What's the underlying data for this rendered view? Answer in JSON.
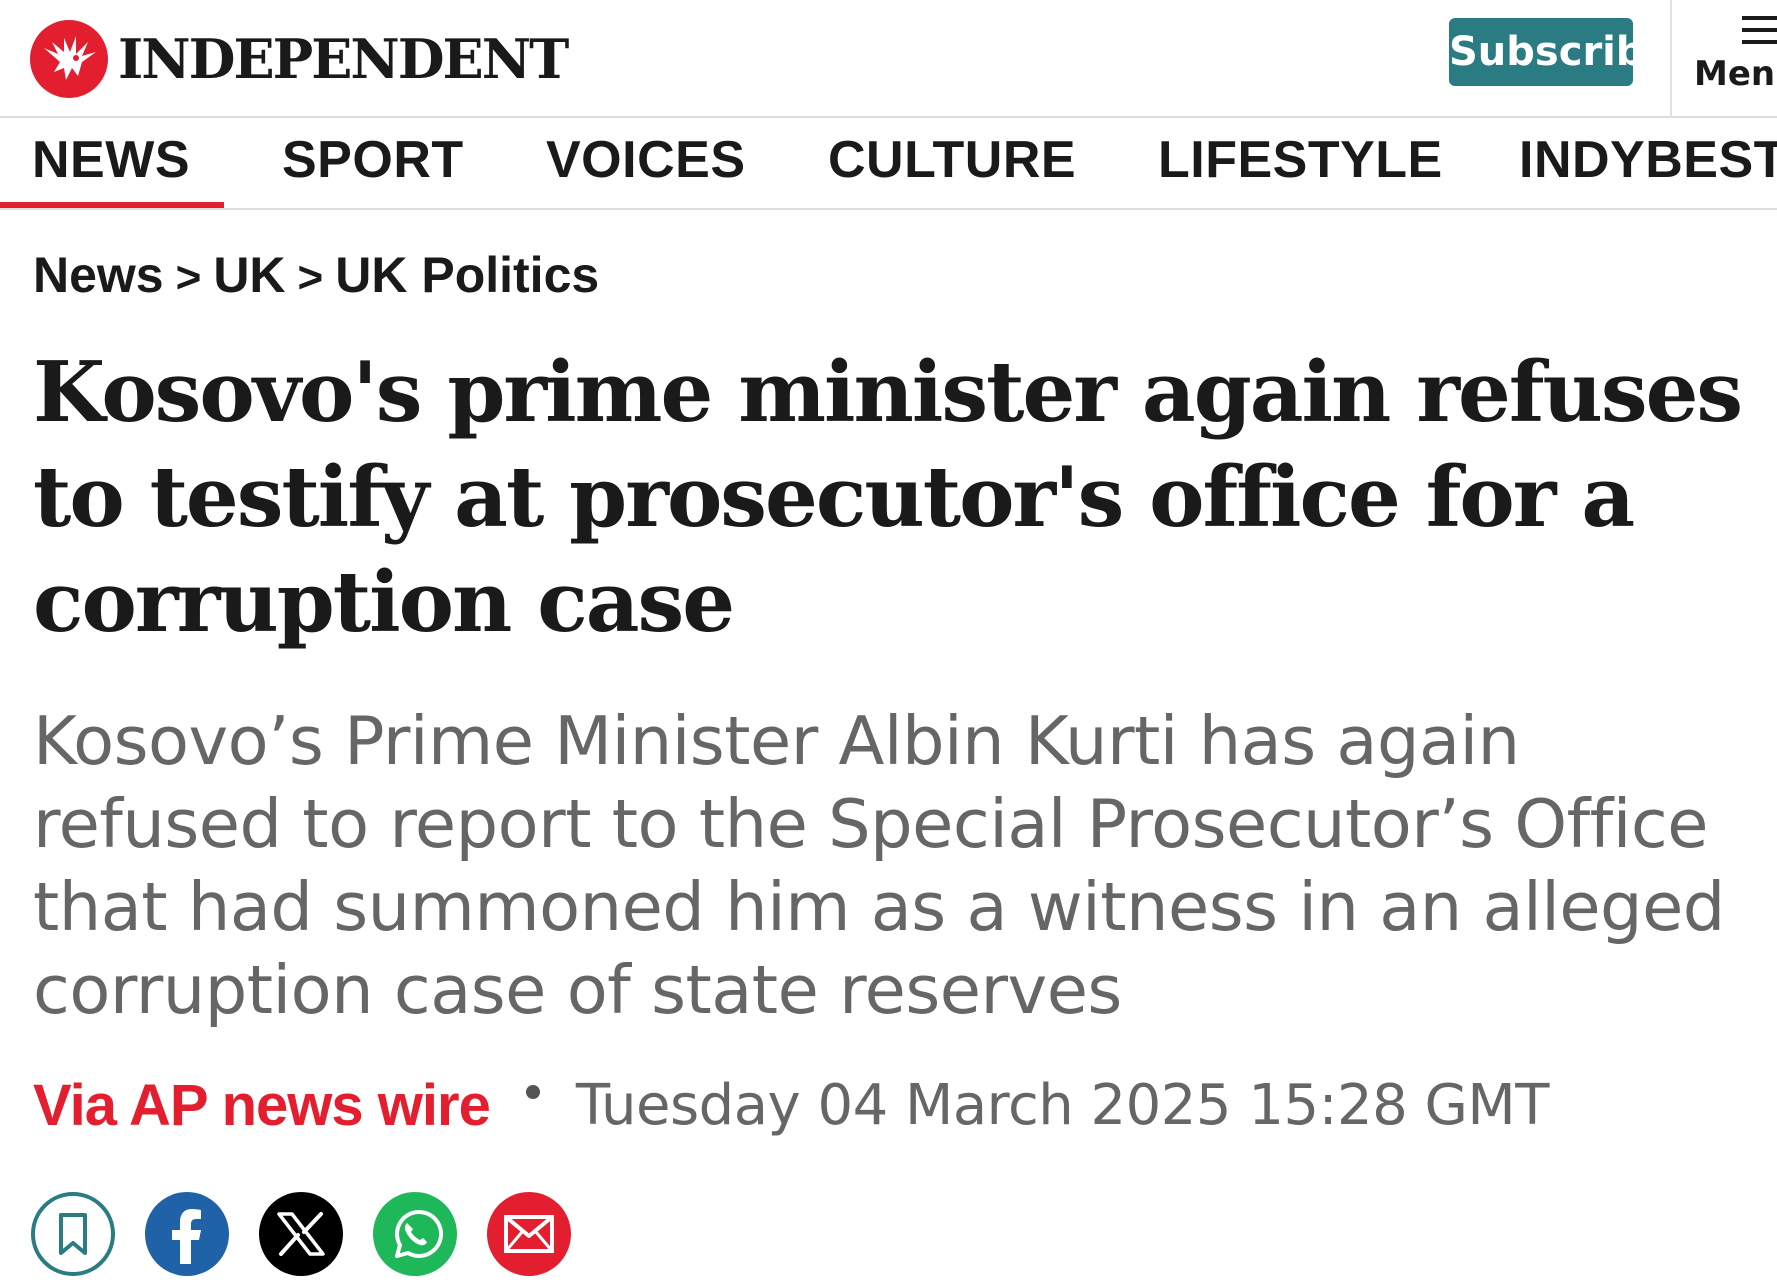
{
  "header": {
    "logo_text": "INDEPENDENT",
    "subscribe_label": "Subscribe",
    "menu_label": "Menu"
  },
  "nav": {
    "items": [
      {
        "label": "NEWS",
        "active": true
      },
      {
        "label": "SPORT",
        "active": false
      },
      {
        "label": "VOICES",
        "active": false
      },
      {
        "label": "CULTURE",
        "active": false
      },
      {
        "label": "LIFESTYLE",
        "active": false
      },
      {
        "label": "INDYBEST",
        "active": false
      }
    ]
  },
  "breadcrumb": {
    "items": [
      "News",
      "UK",
      "UK Politics"
    ],
    "separator": ">"
  },
  "article": {
    "headline": "Kosovo's prime minister again refuses to testify at prosecutor's office for a corruption case",
    "standfirst": "Kosovo’s Prime Minister Albin Kurti has again refused to report to the Special Prosecutor’s Office that had summoned him as a witness in an alleged corruption case of state reserves",
    "byline_author": "Via AP news wire",
    "byline_date": "Tuesday 04 March 2025 15:28 GMT"
  },
  "share": {
    "icons": [
      "bookmark-icon",
      "facebook-icon",
      "x-icon",
      "whatsapp-icon",
      "email-icon"
    ]
  },
  "colors": {
    "brand_red": "#e31e2e",
    "subscribe_teal": "#2a7b82",
    "facebook_blue": "#1f62a8",
    "whatsapp_green": "#1eb75a",
    "x_black": "#000000",
    "standfirst_grey": "#666666"
  }
}
